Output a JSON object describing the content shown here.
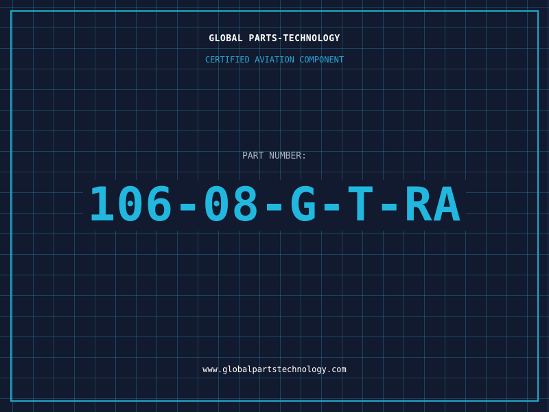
{
  "header": {
    "company": "GLOBAL PARTS-TECHNOLOGY",
    "tagline": "CERTIFIED AVIATION COMPONENT"
  },
  "part": {
    "label": "PART NUMBER:",
    "number": "106-08-G-T-RA"
  },
  "footer": {
    "website": "www.globalpartstechnology.com"
  },
  "colors": {
    "background": "#111a2e",
    "grid": "#1f6f8f",
    "accent": "#21b7de",
    "frame": "#1fa8c8"
  }
}
